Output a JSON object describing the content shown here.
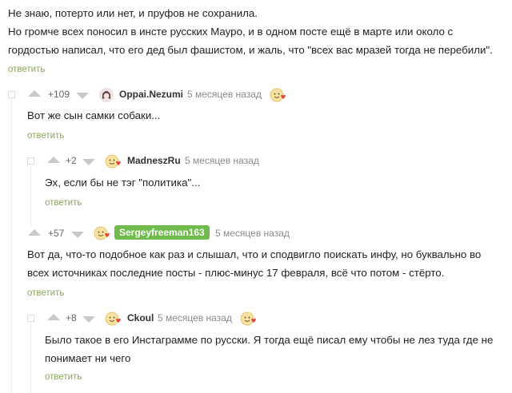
{
  "top_comment": {
    "lines": [
      "Не знаю, потерто или нет, и пруфов не сохранила.",
      "Но громче всех поносил в инсте русских Мауро, и в одном посте ещё в марте или около с",
      "гордостью написал, что его дед был фашистом, и жаль, что \"всех вас мразей тогда не перебили\"."
    ],
    "reply_label": "ответить"
  },
  "comments": [
    {
      "rating": "+109",
      "username": "Oppai.Nezumi",
      "date": "5 месяцев назад",
      "text": [
        "Вот же сын самки собаки..."
      ],
      "reply_label": "ответить"
    },
    {
      "rating": "+2",
      "username": "MadneszRu",
      "date": "5 месяцев назад",
      "text": [
        "Эх, если бы не тэг \"политика\"..."
      ],
      "reply_label": "ответить"
    },
    {
      "rating": "+57",
      "username": "Sergeyfreeman163",
      "date": "5 месяцев назад",
      "text": [
        "Вот да, что-то подобное как раз и слышал, что и сподвигло поискать инфу, но буквально во",
        "всех источниках последние посты - плюс-минус 17 февраля, всё что потом - стёрто."
      ],
      "reply_label": "ответить"
    },
    {
      "rating": "+8",
      "username": "Ckoul",
      "date": "5 месяцев назад",
      "text": [
        "Было такое в его Инстаграмме по русски. Я тогда ещё писал ему чтобы не лез туда где не",
        "понимает ни чего"
      ],
      "reply_label": "ответить"
    }
  ],
  "colors": {
    "reply_link": "#8aa55f",
    "author_badge": "#6fbb4b",
    "vote_arrow": "#c8c8c8"
  },
  "icons": {
    "vote_up": "triangle-up-icon",
    "vote_down": "triangle-down-icon",
    "reaction": "smiley-heart-icon",
    "collapse": "collapse-square-icon"
  }
}
